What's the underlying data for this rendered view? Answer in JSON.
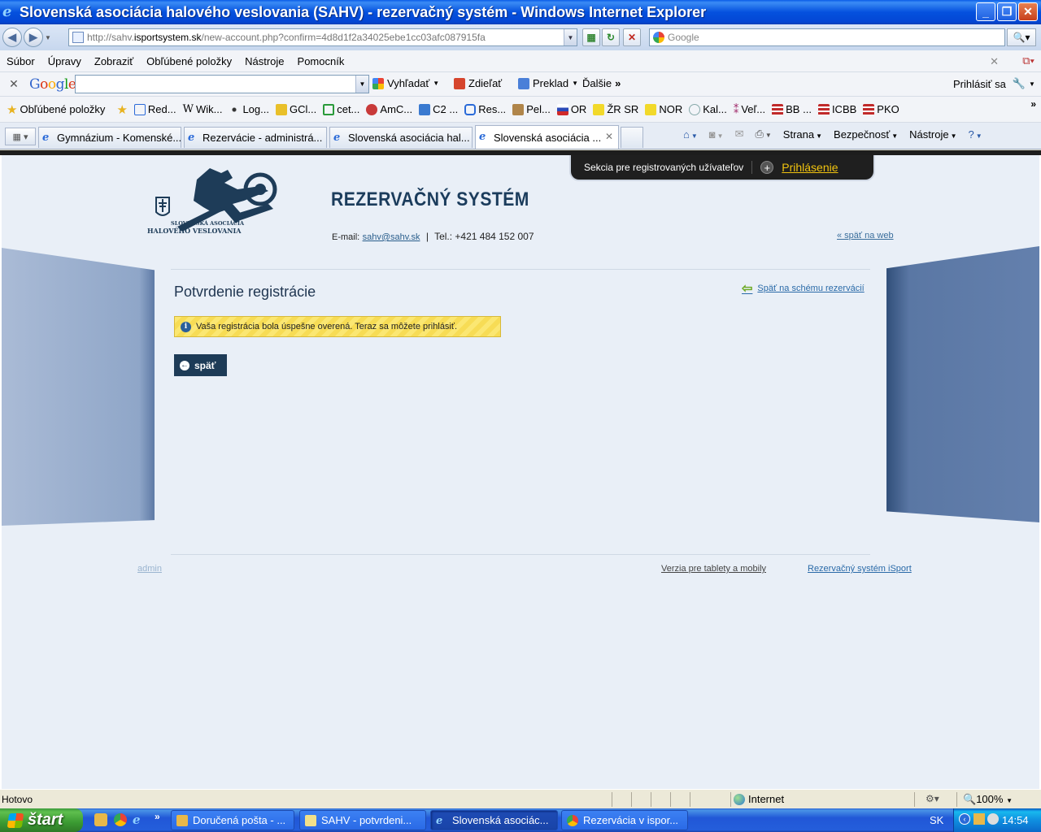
{
  "window": {
    "title": "Slovenská asociácia halového veslovania (SAHV) - rezervačný systém - Windows Internet Explorer",
    "min": "_",
    "max": "❐",
    "close": "✕"
  },
  "address": {
    "url_prefix": "http://sahv.",
    "url_host": "isportsystem.sk",
    "url_rest": "/new-account.php?confirm=4d8d1f2a34025ebe1cc03afc087915fa",
    "search_placeholder": "Google"
  },
  "menu": [
    "Súbor",
    "Úpravy",
    "Zobraziť",
    "Obľúbené položky",
    "Nástroje",
    "Pomocník"
  ],
  "google_toolbar": {
    "logo": [
      "G",
      "o",
      "o",
      "g",
      "l",
      "e"
    ],
    "search": "Vyhľadať",
    "share": "Zdieľať",
    "translate": "Preklad",
    "more": "Ďalšie",
    "signin": "Prihlásiť sa"
  },
  "favorites": {
    "label": "Obľúbené položky",
    "items": [
      "Red...",
      "Wik...",
      "Log...",
      "GCl...",
      "cet...",
      "AmC...",
      "C2 ...",
      "Res...",
      "Pel...",
      "OR",
      "ŽR SR",
      "NOR",
      "Kal...",
      "Veľ...",
      "BB ...",
      "ICBB",
      "PKO"
    ]
  },
  "tabs": [
    {
      "label": "Gymnázium - Komenské..."
    },
    {
      "label": "Rezervácie - administrá..."
    },
    {
      "label": "Slovenská asociácia hal..."
    },
    {
      "label": "Slovenská asociácia ..."
    }
  ],
  "commandbar": {
    "page": "Strana",
    "safety": "Bezpečnosť",
    "tools": "Nástroje"
  },
  "site": {
    "section_text": "Sekcia pre registrovaných užívateľov",
    "login": "Prihlásenie",
    "logo_line1": "SLOVENSKÁ ASOCIÁCIA",
    "logo_line2": "HALOVÉHO VESLOVANIA",
    "title": "REZERVAČNÝ SYSTÉM",
    "email_label": "E-mail:",
    "email": "sahv@sahv.sk",
    "sep": "|",
    "phone": "Tel.: +421 484 152 007",
    "back_to_web": "« späť na web",
    "page_title": "Potvrdenie registrácie",
    "back_to_schema": "Späť na schému rezervácií",
    "message": "Vaša registrácia bola úspešne overená. Teraz sa môžete prihlásiť.",
    "back_button": "späť",
    "admin": "admin",
    "tablet_version": "Verzia pre tablety a mobily",
    "isport": "Rezervačný systém iSport"
  },
  "status": {
    "text": "Hotovo",
    "zone": "Internet",
    "zoom": "100%"
  },
  "taskbar": {
    "start": "štart",
    "tasks": [
      "Doručená pošta - ...",
      "SAHV - potvrdeni...",
      "Slovenská asociác...",
      "Rezervácia v ispor..."
    ],
    "lang": "SK",
    "time": "14:54"
  }
}
